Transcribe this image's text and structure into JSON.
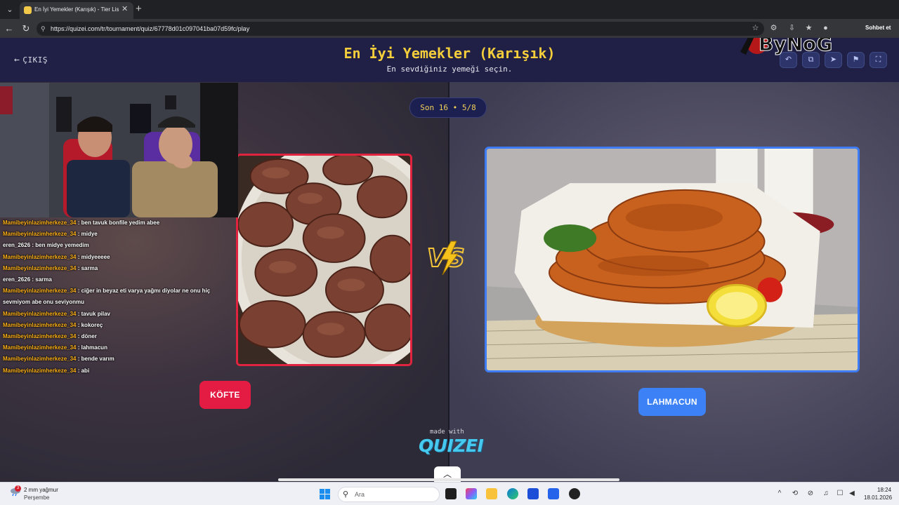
{
  "browser": {
    "tab_title": "En İyi Yemekler (Karışık) - Tier List...",
    "tab_close": "✕",
    "new_tab": "+",
    "url": "https://quizei.com/tr/tournament/quiz/67778d01c097041ba07d59fc/play",
    "profile_label": "Sohbet et"
  },
  "header": {
    "exit_label": "ÇIKIŞ",
    "title": "En İyi Yemekler (Karışık)",
    "subtitle": "En sevdiğiniz yemeği seçin.",
    "buttons": [
      "undo-icon",
      "share-icon",
      "send-icon",
      "flag-icon",
      "fullscreen-icon"
    ]
  },
  "round": {
    "label": "Son 16 • 5/8"
  },
  "left_choice": {
    "label": "KÖFTE",
    "color": "#e41c44"
  },
  "right_choice": {
    "label": "LAHMACUN",
    "color": "#3c82f6"
  },
  "footer": {
    "made_with": "made with",
    "brand": "QUIZEI"
  },
  "overlay": {
    "logo_text": "ByNoGame"
  },
  "chat": [
    {
      "user": "Mamibeyinlazimherkeze_34",
      "message": "ben tavuk bonfile yedim abee",
      "highlight": true
    },
    {
      "user": "Mamibeyinlazimherkeze_34",
      "message": "midye",
      "highlight": true
    },
    {
      "user": "eren_2626",
      "message": "ben midye yemedim",
      "highlight": false
    },
    {
      "user": "Mamibeyinlazimherkeze_34",
      "message": "midyeeeee",
      "highlight": true
    },
    {
      "user": "Mamibeyinlazimherkeze_34",
      "message": "sarma",
      "highlight": true
    },
    {
      "user": "eren_2626",
      "message": "sarma",
      "highlight": false
    },
    {
      "user": "Mamibeyinlazimherkeze_34",
      "message": "ciğer in beyaz eti varya yağmı diyolar ne onu hiç",
      "highlight": true
    },
    {
      "user": "",
      "message": "sevmiyom abe onu seviyonmu",
      "highlight": false
    },
    {
      "user": "Mamibeyinlazimherkeze_34",
      "message": "tavuk pilav",
      "highlight": true
    },
    {
      "user": "Mamibeyinlazimherkeze_34",
      "message": "kokoreç",
      "highlight": true
    },
    {
      "user": "Mamibeyinlazimherkeze_34",
      "message": "döner",
      "highlight": true
    },
    {
      "user": "Mamibeyinlazimherkeze_34",
      "message": "lahmacun",
      "highlight": true
    },
    {
      "user": "Mamibeyinlazimherkeze_34",
      "message": "bende varım",
      "highlight": true
    },
    {
      "user": "Mamibeyinlazimherkeze_34",
      "message": "abi",
      "highlight": true
    }
  ],
  "taskbar": {
    "weather_badge": "3",
    "weather_temp": "2 mm yağmur",
    "weather_day": "Perşembe",
    "search_placeholder": "Ara",
    "time": "18:24",
    "date": "18.01.2026"
  }
}
